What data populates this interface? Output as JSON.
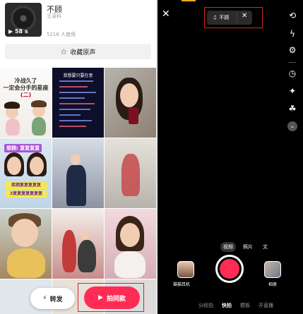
{
  "left": {
    "song": {
      "title": "不顾",
      "artist": "王泽科",
      "duration": "▶ 58 s",
      "users": "5216 人使用"
    },
    "collect_button": "收藏原声",
    "cells": [
      {
        "lines": [
          "冷战久了",
          "一定会分手的星座",
          "(二)"
        ]
      },
      {
        "title": "我想要只要在意"
      },
      {},
      {
        "banner": "想拥: 复复复复",
        "yellow1": "接拥复复复复复",
        "yellow2": "3复复复复复复复"
      },
      {},
      {},
      {},
      {},
      {},
      {},
      {},
      {}
    ],
    "forward_button": "转发",
    "shoot_button": "拍同款"
  },
  "right": {
    "music_pill": {
      "icon": "♫",
      "name": "不顾"
    },
    "mode_tabs": [
      "视频",
      "照片",
      "文"
    ],
    "effect_label": "猫猫耳机",
    "album_label": "相册",
    "bottom_tabs": [
      "分段拍",
      "快拍",
      "模板",
      "开直播"
    ]
  }
}
